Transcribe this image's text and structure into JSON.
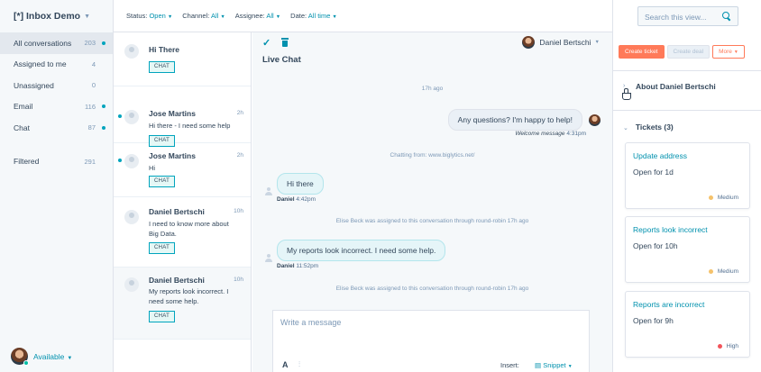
{
  "sidebar": {
    "inbox_title": "[*] Inbox Demo",
    "items": [
      {
        "label": "All conversations",
        "count": "203",
        "unread": true,
        "active": true
      },
      {
        "label": "Assigned to me",
        "count": "4",
        "unread": false,
        "active": false
      },
      {
        "label": "Unassigned",
        "count": "0",
        "unread": false,
        "active": false
      },
      {
        "label": "Email",
        "count": "116",
        "unread": true,
        "active": false
      },
      {
        "label": "Chat",
        "count": "87",
        "unread": true,
        "active": false
      }
    ],
    "filtered": {
      "label": "Filtered",
      "count": "291"
    },
    "availability": "Available"
  },
  "filters": [
    {
      "key": "Status:",
      "value": "Open"
    },
    {
      "key": "Channel:",
      "value": "All"
    },
    {
      "key": "Assignee:",
      "value": "All"
    },
    {
      "key": "Date:",
      "value": "All time"
    }
  ],
  "conversations": [
    {
      "name": "Hi There",
      "time": "",
      "preview": "",
      "tag": "CHAT",
      "unread": false
    },
    {
      "name": "Jose Martins",
      "time": "2h",
      "preview": "Hi there - I need some help",
      "tag": "CHAT",
      "unread": true
    },
    {
      "name": "Jose Martins",
      "time": "2h",
      "preview": "Hi",
      "tag": "CHAT",
      "unread": true
    },
    {
      "name": "Daniel Bertschi",
      "time": "10h",
      "preview": "I need to know more about Big Data.",
      "tag": "CHAT",
      "unread": false
    },
    {
      "name": "Daniel Bertschi",
      "time": "10h",
      "preview": "My reports look incorrect. I need some help.",
      "tag": "CHAT",
      "unread": false
    }
  ],
  "chat": {
    "assignee": "Daniel Bertschi",
    "title": "Live Chat",
    "time_divider": "17h ago",
    "welcome_text": "Any questions? I'm happy to help!",
    "welcome_meta_label": "Welcome message",
    "welcome_meta_time": "4:31pm",
    "chatting_from": "Chatting from: www.biglytics.net/",
    "msg1_text": "Hi there",
    "msg1_sender": "Daniel",
    "msg1_time": "4:42pm",
    "assign_note_1": "Elise Beck was assigned to this conversation through round-robin 17h ago",
    "msg2_text": "My reports look incorrect. I need some help.",
    "msg2_sender": "Daniel",
    "msg2_time": "11:52pm",
    "assign_note_2": "Elise Beck was assigned to this conversation through round-robin 17h ago",
    "composer_placeholder": "Write a message",
    "format_label": "A",
    "insert_label": "Insert:",
    "snippet_label": "Snippet"
  },
  "right_panel": {
    "search_placeholder": "Search this view...",
    "create_ticket": "Create ticket",
    "create_deal": "Create deal",
    "more": "More",
    "about_label": "About Daniel Bertschi",
    "tickets_label": "Tickets (3)",
    "tickets": [
      {
        "name": "Update address",
        "status": "Open for 1d",
        "priority": "Medium",
        "priority_color": "#f5c26b"
      },
      {
        "name": "Reports look incorrect",
        "status": "Open for 10h",
        "priority": "Medium",
        "priority_color": "#f5c26b"
      },
      {
        "name": "Reports are incorrect",
        "status": "Open for 9h",
        "priority": "High",
        "priority_color": "#f2545b"
      }
    ]
  },
  "colors": {
    "accent": "#0091ae",
    "primary_button": "#ff7a59",
    "unread_dot": "#00a4bd"
  }
}
